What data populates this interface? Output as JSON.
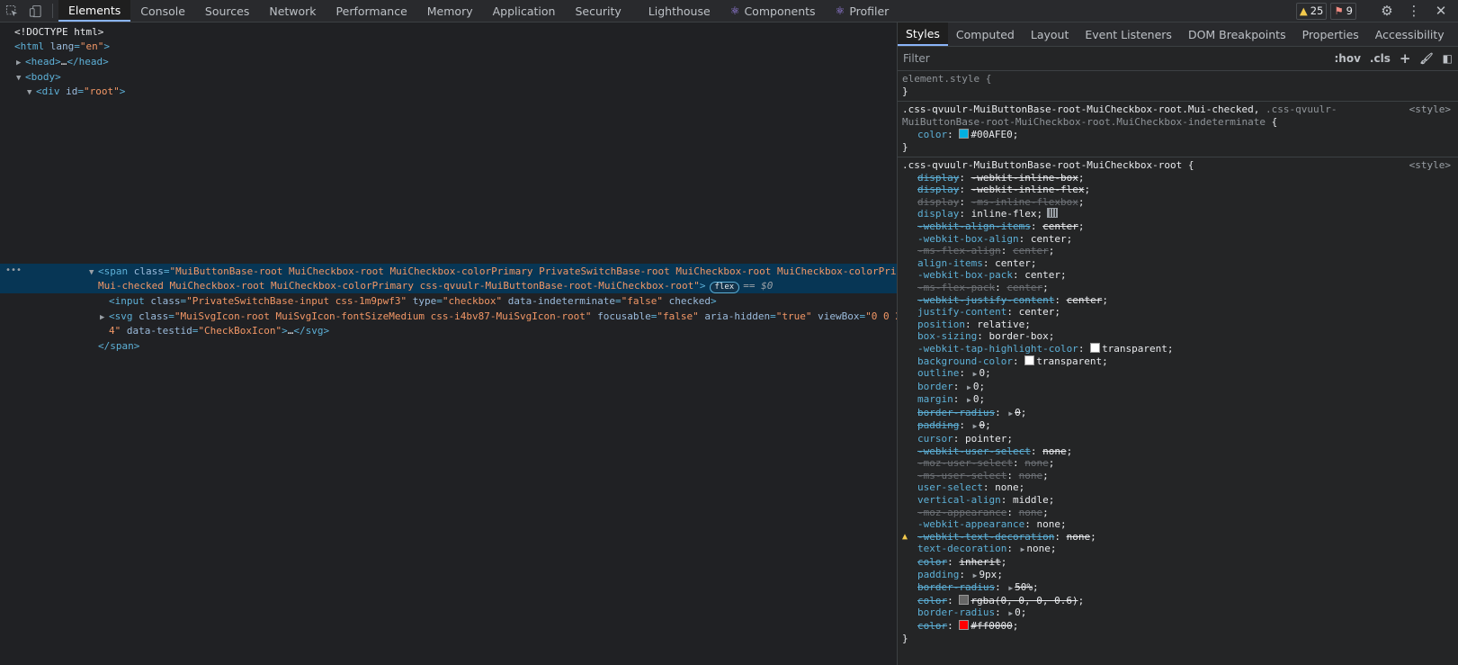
{
  "toolbar": {
    "tabs": [
      "Elements",
      "Console",
      "Sources",
      "Network",
      "Performance",
      "Memory",
      "Application",
      "Security",
      "Lighthouse",
      "Components",
      "Profiler"
    ],
    "warnings": "25",
    "errors": "9"
  },
  "dom": {
    "doctype": "<!DOCTYPE html>",
    "html_open": "<html",
    "html_lang_attr": "lang",
    "html_lang_val": "\"en\"",
    "head": "<head>",
    "head_ellipsis": "…",
    "head_close": "</head>",
    "body": "<body>",
    "div_open": "<div",
    "div_id_attr": "id",
    "div_id_val": "\"root\"",
    "span_line1_tag": "<span",
    "span_class_attr": "class",
    "span_class_val_1": "\"MuiButtonBase-root MuiCheckbox-root MuiCheckbox-colorPrimary PrivateSwitchBase-root MuiCheckbox-root MuiCheckbox-colorPrimary",
    "span_class_val_2": "Mui-checked MuiCheckbox-root MuiCheckbox-colorPrimary css-qvuulr-MuiButtonBase-root-MuiCheckbox-root\"",
    "flex_badge": "flex",
    "eq_dollar": "== $0",
    "input_line": {
      "tag": "<input",
      "class_attr": "class",
      "class_val": "\"PrivateSwitchBase-input css-1m9pwf3\"",
      "type_attr": "type",
      "type_val": "\"checkbox\"",
      "data_attr": "data-indeterminate",
      "data_val": "\"false\"",
      "checked": "checked"
    },
    "svg_line": {
      "tag": "<svg",
      "class_attr": "class",
      "class_val": "\"MuiSvgIcon-root MuiSvgIcon-fontSizeMedium css-i4bv87-MuiSvgIcon-root\"",
      "focusable_attr": "focusable",
      "focusable_val": "\"false\"",
      "aria_attr": "aria-hidden",
      "aria_val": "\"true\"",
      "viewbox_attr": "viewBox",
      "viewbox_val_1": "\"0 0 24 2",
      "viewbox_val_2": "4\"",
      "testid_attr": "data-testid",
      "testid_val": "\"CheckBoxIcon\"",
      "close": "</svg>"
    },
    "span_close": "</span>"
  },
  "styles": {
    "tabs": [
      "Styles",
      "Computed",
      "Layout",
      "Event Listeners",
      "DOM Breakpoints",
      "Properties",
      "Accessibility"
    ],
    "filter_placeholder": "Filter",
    "hov": ":hov",
    "cls": ".cls",
    "element_style": "element.style {",
    "close_brace": "}",
    "rule1": {
      "selector_bright": ".css-qvuulr-MuiButtonBase-root-MuiCheckbox-root.Mui-checked,",
      "selector_dim_1": " .css-qvuulr-",
      "selector_dim_2": "MuiButtonBase-root-MuiCheckbox-root.MuiCheckbox-indeterminate",
      "open": " {",
      "source": "<style>",
      "prop": "color",
      "value": "#00AFE0",
      "swatch": "#00AFE0"
    },
    "rule2": {
      "selector": ".css-qvuulr-MuiButtonBase-root-MuiCheckbox-root {",
      "source": "<style>",
      "props": [
        {
          "n": "display",
          "v": "-webkit-inline-box",
          "strike": true,
          "dim": false
        },
        {
          "n": "display",
          "v": "-webkit-inline-flex",
          "strike": true,
          "dim": false
        },
        {
          "n": "display",
          "v": "-ms-inline-flexbox",
          "strike": true,
          "dim": true
        },
        {
          "n": "display",
          "v": "inline-flex",
          "strike": false,
          "dim": false,
          "grid": true
        },
        {
          "n": "-webkit-align-items",
          "v": "center",
          "strike": true,
          "dim": false
        },
        {
          "n": "-webkit-box-align",
          "v": "center",
          "strike": false,
          "dim": false
        },
        {
          "n": "-ms-flex-align",
          "v": "center",
          "strike": true,
          "dim": true
        },
        {
          "n": "align-items",
          "v": "center",
          "strike": false,
          "dim": false
        },
        {
          "n": "-webkit-box-pack",
          "v": "center",
          "strike": false,
          "dim": false
        },
        {
          "n": "-ms-flex-pack",
          "v": "center",
          "strike": true,
          "dim": true
        },
        {
          "n": "-webkit-justify-content",
          "v": "center",
          "strike": true,
          "dim": false
        },
        {
          "n": "justify-content",
          "v": "center",
          "strike": false,
          "dim": false
        },
        {
          "n": "position",
          "v": "relative",
          "strike": false,
          "dim": false
        },
        {
          "n": "box-sizing",
          "v": "border-box",
          "strike": false,
          "dim": false
        },
        {
          "n": "-webkit-tap-highlight-color",
          "v": "transparent",
          "strike": false,
          "dim": false,
          "swatch": "#ffffff"
        },
        {
          "n": "background-color",
          "v": "transparent",
          "strike": false,
          "dim": false,
          "swatch": "#ffffff"
        },
        {
          "n": "outline",
          "v": "0",
          "strike": false,
          "dim": false,
          "exp": true
        },
        {
          "n": "border",
          "v": "0",
          "strike": false,
          "dim": false,
          "exp": true
        },
        {
          "n": "margin",
          "v": "0",
          "strike": false,
          "dim": false,
          "exp": true
        },
        {
          "n": "border-radius",
          "v": "0",
          "strike": true,
          "dim": false,
          "exp": true
        },
        {
          "n": "padding",
          "v": "0",
          "strike": true,
          "dim": false,
          "exp": true
        },
        {
          "n": "cursor",
          "v": "pointer",
          "strike": false,
          "dim": false
        },
        {
          "n": "-webkit-user-select",
          "v": "none",
          "strike": true,
          "dim": false
        },
        {
          "n": "-moz-user-select",
          "v": "none",
          "strike": true,
          "dim": true
        },
        {
          "n": "-ms-user-select",
          "v": "none",
          "strike": true,
          "dim": true
        },
        {
          "n": "user-select",
          "v": "none",
          "strike": false,
          "dim": false
        },
        {
          "n": "vertical-align",
          "v": "middle",
          "strike": false,
          "dim": false
        },
        {
          "n": "-moz-appearance",
          "v": "none",
          "strike": true,
          "dim": true
        },
        {
          "n": "-webkit-appearance",
          "v": "none",
          "strike": false,
          "dim": false
        },
        {
          "n": "-webkit-text-decoration",
          "v": "none",
          "strike": true,
          "dim": false,
          "warn": true
        },
        {
          "n": "text-decoration",
          "v": "none",
          "strike": false,
          "dim": false,
          "exp": true
        },
        {
          "n": "color",
          "v": "inherit",
          "strike": true,
          "dim": false
        },
        {
          "n": "padding",
          "v": "9px",
          "strike": false,
          "dim": false,
          "exp": true
        },
        {
          "n": "border-radius",
          "v": "50%",
          "strike": true,
          "dim": false,
          "exp": true
        },
        {
          "n": "color",
          "v": "rgba(0, 0, 0, 0.6)",
          "strike": true,
          "dim": false,
          "swatch": "#666666"
        },
        {
          "n": "border-radius",
          "v": "0",
          "strike": false,
          "dim": false,
          "exp": true
        },
        {
          "n": "color",
          "v": "#ff0000",
          "strike": true,
          "dim": false,
          "swatch": "#ff0000"
        }
      ]
    }
  }
}
